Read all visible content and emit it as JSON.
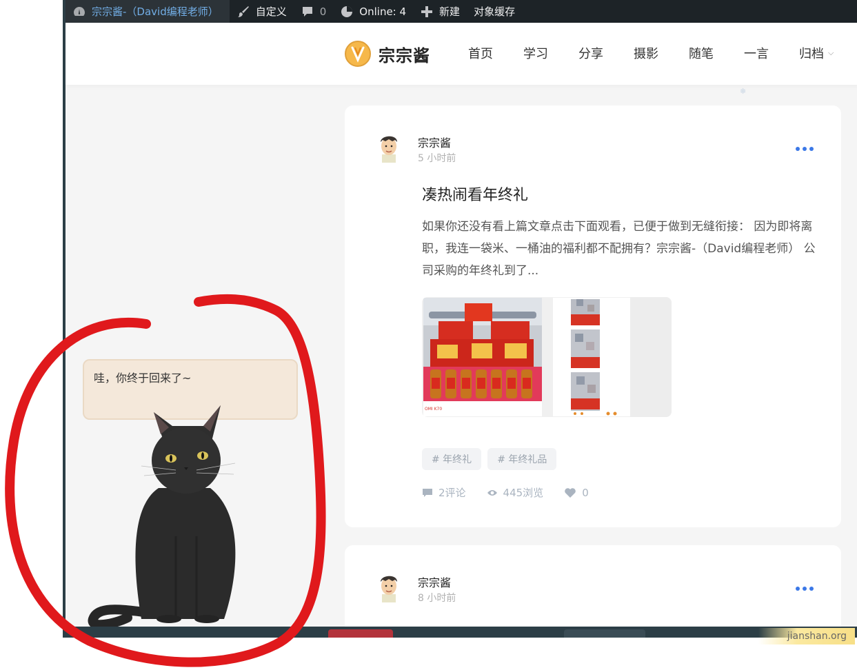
{
  "admin_bar": {
    "site_title": "宗宗酱-（David编程老师）",
    "customize": "自定义",
    "comments_count": "0",
    "online": "Online: 4",
    "new": "新建",
    "object_cache": "对象缓存"
  },
  "header": {
    "logo_text": "宗宗酱",
    "nav": [
      "首页",
      "学习",
      "分享",
      "摄影",
      "随笔",
      "一言",
      "归档"
    ]
  },
  "posts": [
    {
      "author": "宗宗酱",
      "time": "5 小时前",
      "title": "凑热闹看年终礼",
      "excerpt": "如果你还没有看上篇文章点击下面观看，已便于做到无缝衔接： 因为即将离职，我连一袋米、一桶油的福利都不配拥有？宗宗酱-（David编程老师） 公司采购的年终礼到了...",
      "tags": [
        "# 年终礼",
        "# 年终礼品"
      ],
      "comments": "2评论",
      "views": "445浏览",
      "likes": "0",
      "photo_caption": "OMI K70"
    },
    {
      "author": "宗宗酱",
      "time": "8 小时前"
    }
  ],
  "pet": {
    "message": "哇，你终于回来了~"
  },
  "watermark": "jianshan.org",
  "colors": {
    "accent": "#3b78e7",
    "admin_bar": "#1d2327",
    "annotation": "#e0191c"
  }
}
